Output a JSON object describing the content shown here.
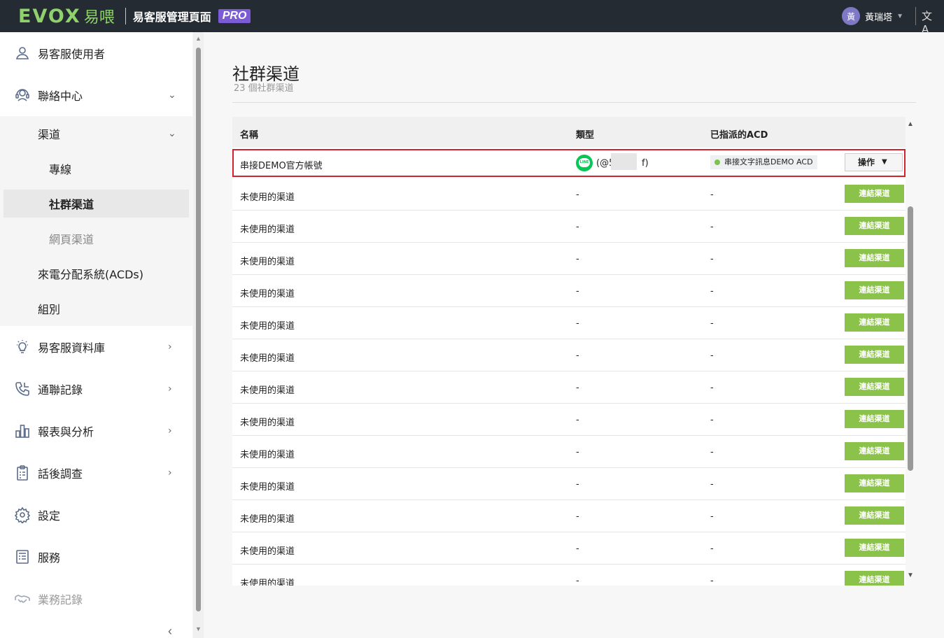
{
  "topbar": {
    "logo_text": "EVOX",
    "logo_cn": "易喂",
    "app_title": "易客服管理頁面",
    "badge": "PRO",
    "user_avatar": "黃",
    "user_name": "黃瑞塔",
    "translate_icon": "文A"
  },
  "sidebar": {
    "items": [
      {
        "label": "易客服使用者",
        "icon": "user-icon"
      },
      {
        "label": "聯絡中心",
        "icon": "headset-icon"
      },
      {
        "label": "易客服資料庫",
        "icon": "lightbulb-icon"
      },
      {
        "label": "通聯記錄",
        "icon": "phone-log-icon"
      },
      {
        "label": "報表與分析",
        "icon": "bar-chart-icon"
      },
      {
        "label": "話後調查",
        "icon": "clipboard-icon"
      },
      {
        "label": "設定",
        "icon": "gear-icon"
      },
      {
        "label": "服務",
        "icon": "document-icon"
      },
      {
        "label": "業務記錄",
        "icon": "handshake-icon"
      }
    ],
    "sub": {
      "channels": "渠道",
      "dedicated": "專線",
      "social": "社群渠道",
      "web": "網頁渠道",
      "acds": "來電分配系統(ACDs)",
      "groups": "組別"
    }
  },
  "main": {
    "title": "社群渠道",
    "subtitle": "23 個社群渠道",
    "columns": [
      "名稱",
      "類型",
      "已指派的ACD"
    ],
    "first_row": {
      "name": "串接DEMO官方帳號",
      "handle_prefix": "(@5",
      "handle_suffix": "f)",
      "line_text": "LINE",
      "acd": "串接文字訊息DEMO ACD",
      "action": "操作"
    },
    "unused_label": "未使用的渠道",
    "dash": "-",
    "connect_label": "連結渠道",
    "unused_rows": 13
  },
  "colors": {
    "topbar": "#242b33",
    "brand_green": "#8fd16a",
    "connect_btn": "#8bc34a",
    "highlight_border": "#d2222d",
    "pro_badge": "#7c5cd6"
  }
}
